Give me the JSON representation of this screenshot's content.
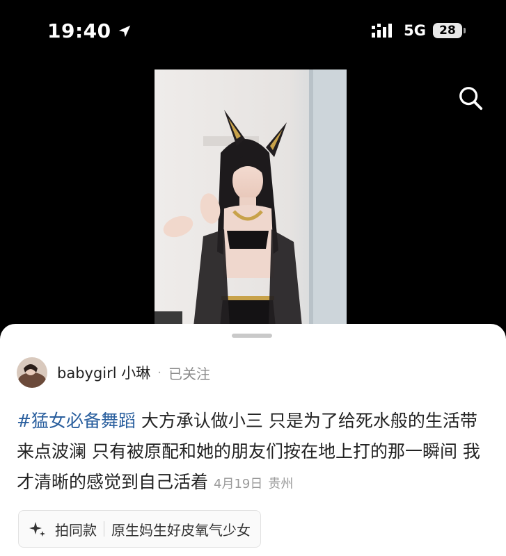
{
  "status_bar": {
    "time": "19:40",
    "network": "5G",
    "battery": "28",
    "icons": [
      "location-arrow-icon",
      "signal-icon",
      "battery-icon"
    ]
  },
  "header": {
    "icons": [
      "search-icon"
    ]
  },
  "post": {
    "author": "babygirl 小琳",
    "separator": "·",
    "follow_status": "已关注",
    "hashtag": "#猛女必备舞蹈",
    "caption": " 大方承认做小三 只是为了给死水般的生活带来点波澜 只有被原配和她的朋友们按在地上打的那一瞬间 我才清晰的感觉到自己活着",
    "date": "4月19日",
    "location": "贵州"
  },
  "template_chip": {
    "icon": "sparkle-icon",
    "label": "拍同款",
    "template_name": "原生妈生好皮氧气少女"
  },
  "colors": {
    "background": "#000000",
    "sheet": "#ffffff",
    "hashtag": "#2a5f9e",
    "meta": "#9a9a9a"
  }
}
